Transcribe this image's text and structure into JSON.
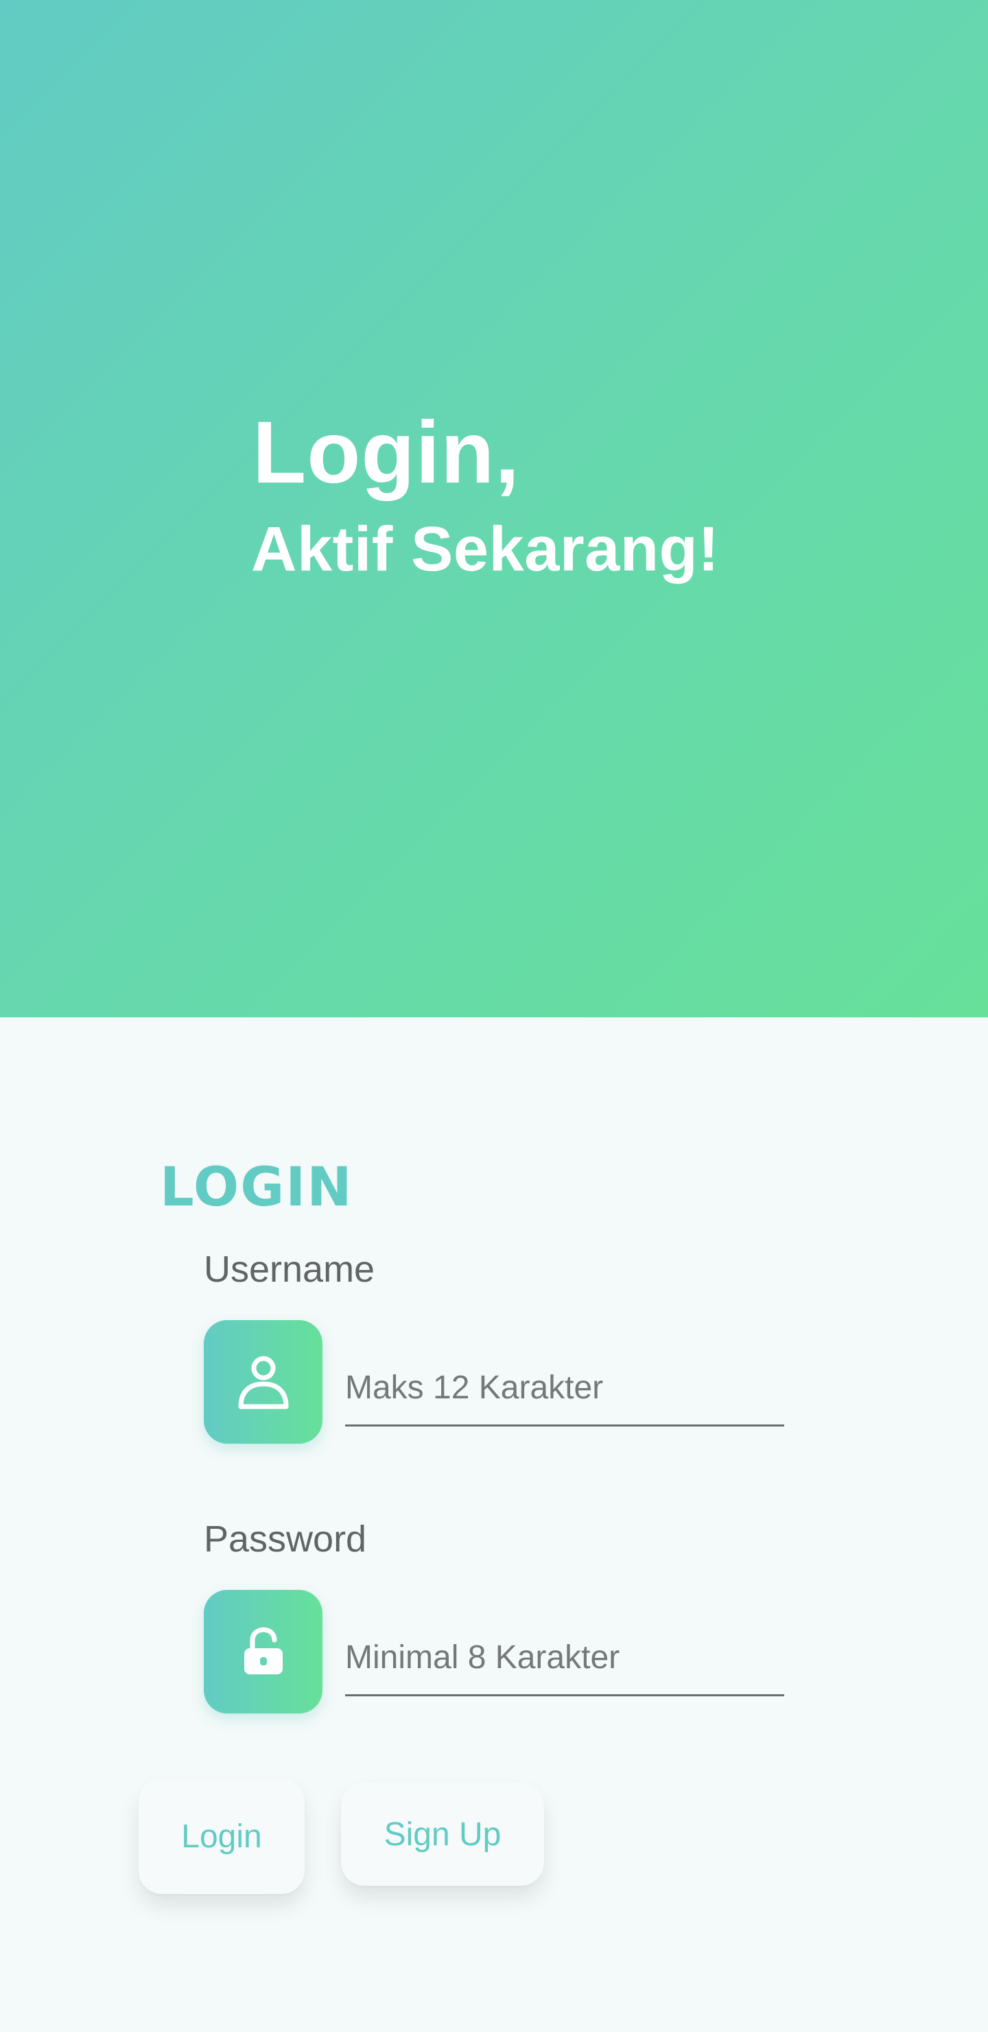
{
  "hero": {
    "title": "Login,",
    "subtitle": "Aktif Sekarang!"
  },
  "form": {
    "title": "LOGIN",
    "username": {
      "label": "Username",
      "placeholder": "Maks 12 Karakter",
      "icon": "user-icon"
    },
    "password": {
      "label": "Password",
      "placeholder": "Minimal 8 Karakter",
      "icon": "unlock-icon"
    },
    "buttons": {
      "login_label": "Login",
      "signup_label": "Sign Up"
    }
  },
  "colors": {
    "accent_teal": "#62cbc4",
    "accent_green": "#67e09a",
    "background": "#f4f9f9",
    "label_text": "#616464"
  }
}
